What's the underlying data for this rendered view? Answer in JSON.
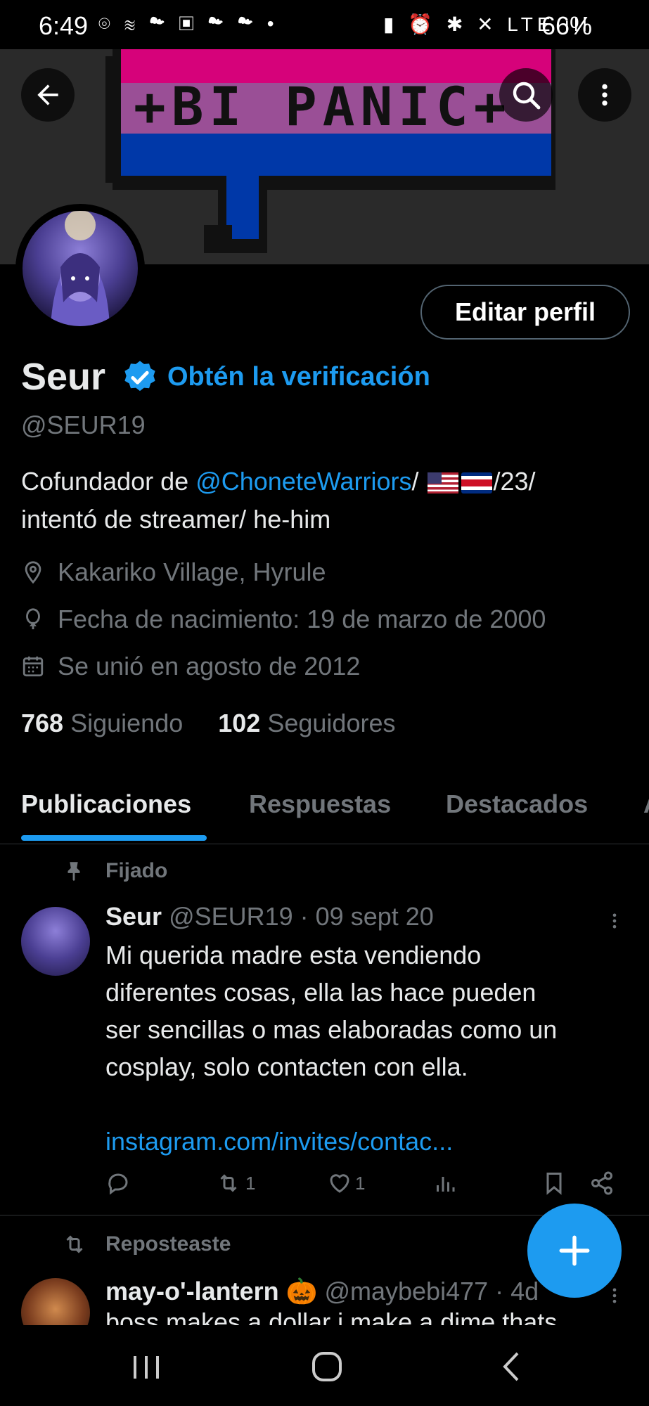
{
  "status_bar": {
    "time": "6:49",
    "left_icons": "⌾ ≋ ☁ ▣ ☁ ☁ •",
    "right_icons": "▮ ⏰ ✱ ✕ LTE ıll",
    "battery": "66%"
  },
  "banner": {
    "text": "+BI PANIC+",
    "colors": {
      "pink": "#d6027a",
      "purple": "#9a4f96",
      "blue": "#0038a8"
    }
  },
  "profile": {
    "name": "Seur",
    "verify_link": "Obtén la verificación",
    "handle": "@SEUR19",
    "edit_button": "Editar perfil",
    "bio_prefix": "Cofundador de ",
    "bio_mention": "@ChoneteWarriors",
    "bio_sep1": "/ ",
    "bio_sep2": "/23/",
    "bio_line2": "intentó de streamer/ he-him",
    "location": "Kakariko Village, Hyrule",
    "birthday": "Fecha de nacimiento: 19 de marzo de 2000",
    "joined": "Se unió en agosto de 2012",
    "following_count": "768",
    "following_label": "Siguiendo",
    "followers_count": "102",
    "followers_label": "Seguidores"
  },
  "tabs": [
    {
      "label": "Publicaciones",
      "active": true
    },
    {
      "label": "Respuestas"
    },
    {
      "label": "Destacados"
    },
    {
      "label": "A"
    }
  ],
  "pinned_post": {
    "pinned_label": "Fijado",
    "author": "Seur",
    "handle_date": "@SEUR19 · 09 sept 20",
    "text_lines": [
      "Mi querida madre esta vendiendo",
      "diferentes cosas, ella las hace pueden",
      "ser sencillas o mas elaboradas como un",
      "cosplay, solo contacten con ella."
    ],
    "link": "instagram.com/invites/contac...",
    "retweets": "1",
    "likes": "1"
  },
  "repost": {
    "label": "Reposteaste",
    "author": "may-o'-lantern 🎃",
    "handle_date": "@maybebi477 · 4d",
    "text": "boss makes a dollar i make a dime thats"
  },
  "colors": {
    "accent": "#1d9bf0",
    "text": "#e7e9ea",
    "muted": "#71767b",
    "background": "#000000"
  }
}
